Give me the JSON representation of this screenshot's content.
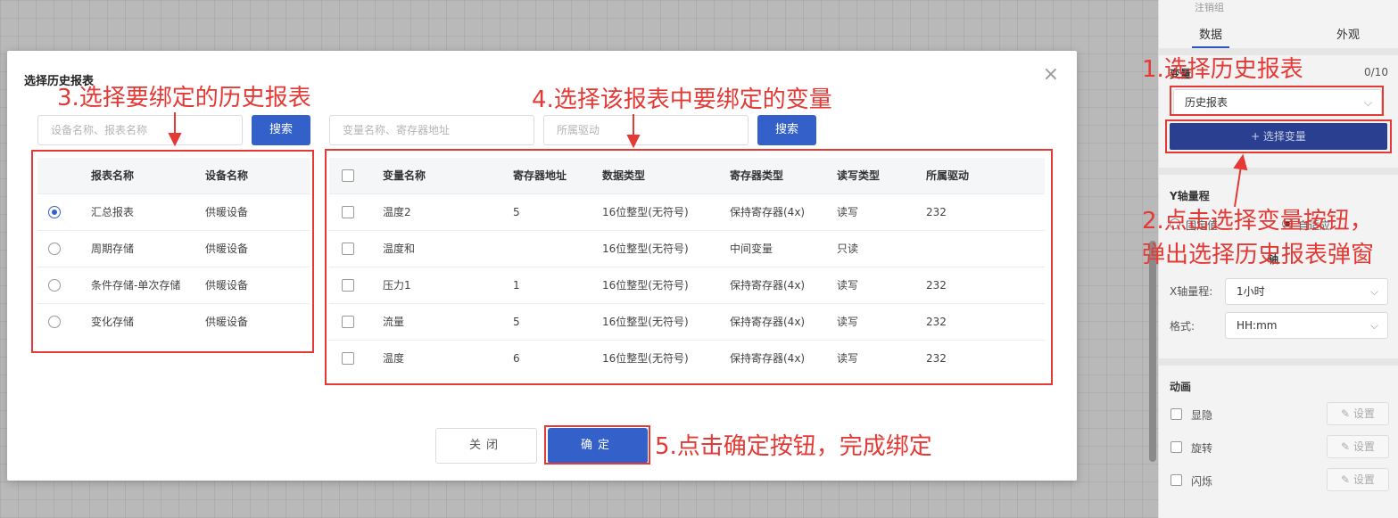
{
  "right_panel": {
    "top_label": "注销组",
    "tabs": [
      "数据",
      "外观"
    ],
    "variable_label": "变量",
    "variable_count": "0/10",
    "select_value": "历史报表",
    "select_variable_btn": "+ 选择变量",
    "y_axis_label": "Y轴量程",
    "y_opt_fixed": "固定值",
    "y_opt_adaptive": "自适应",
    "x_axis_section": "轴",
    "x_range_label": "X轴量程:",
    "x_range_value": "1小时",
    "format_label": "格式:",
    "format_value": "HH:mm",
    "animation_label": "动画",
    "anim_items": [
      "显隐",
      "旋转",
      "闪烁"
    ],
    "set_btn": "设置"
  },
  "modal": {
    "title": "选择历史报表",
    "left_search_placeholder": "设备名称、报表名称",
    "right_search_placeholder": "变量名称、寄存器地址",
    "driver_placeholder": "所属驱动",
    "search_btn": "搜索",
    "report_table": {
      "headers": [
        "报表名称",
        "设备名称"
      ],
      "rows": [
        {
          "name": "汇总报表",
          "device": "供暖设备",
          "selected": true
        },
        {
          "name": "周期存储",
          "device": "供暖设备",
          "selected": false
        },
        {
          "name": "条件存储-单次存储",
          "device": "供暖设备",
          "selected": false
        },
        {
          "name": "变化存储",
          "device": "供暖设备",
          "selected": false
        }
      ]
    },
    "var_table": {
      "headers": [
        "变量名称",
        "寄存器地址",
        "数据类型",
        "寄存器类型",
        "读写类型",
        "所属驱动"
      ],
      "rows": [
        [
          "温度2",
          "5",
          "16位整型(无符号)",
          "保持寄存器(4x)",
          "读写",
          "232"
        ],
        [
          "温度和",
          "",
          "16位整型(无符号)",
          "中间变量",
          "只读",
          ""
        ],
        [
          "压力1",
          "1",
          "16位整型(无符号)",
          "保持寄存器(4x)",
          "读写",
          "232"
        ],
        [
          "流量",
          "5",
          "16位整型(无符号)",
          "保持寄存器(4x)",
          "读写",
          "232"
        ],
        [
          "温度",
          "6",
          "16位整型(无符号)",
          "保持寄存器(4x)",
          "读写",
          "232"
        ]
      ]
    },
    "close_btn": "关闭",
    "ok_btn": "确定"
  },
  "annotations": {
    "step1": "1.选择历史报表",
    "step2_line1": "2.点击选择变量按钮，",
    "step2_line2": "弹出选择历史报表弹窗",
    "step3": "3.选择要绑定的历史报表",
    "step4": "4.选择该报表中要绑定的变量",
    "step5": "5.点击确定按钮，完成绑定"
  },
  "colors": {
    "accent": "#3360c9",
    "annotation": "#e53935",
    "panel_btn": "#2a3f8f"
  }
}
